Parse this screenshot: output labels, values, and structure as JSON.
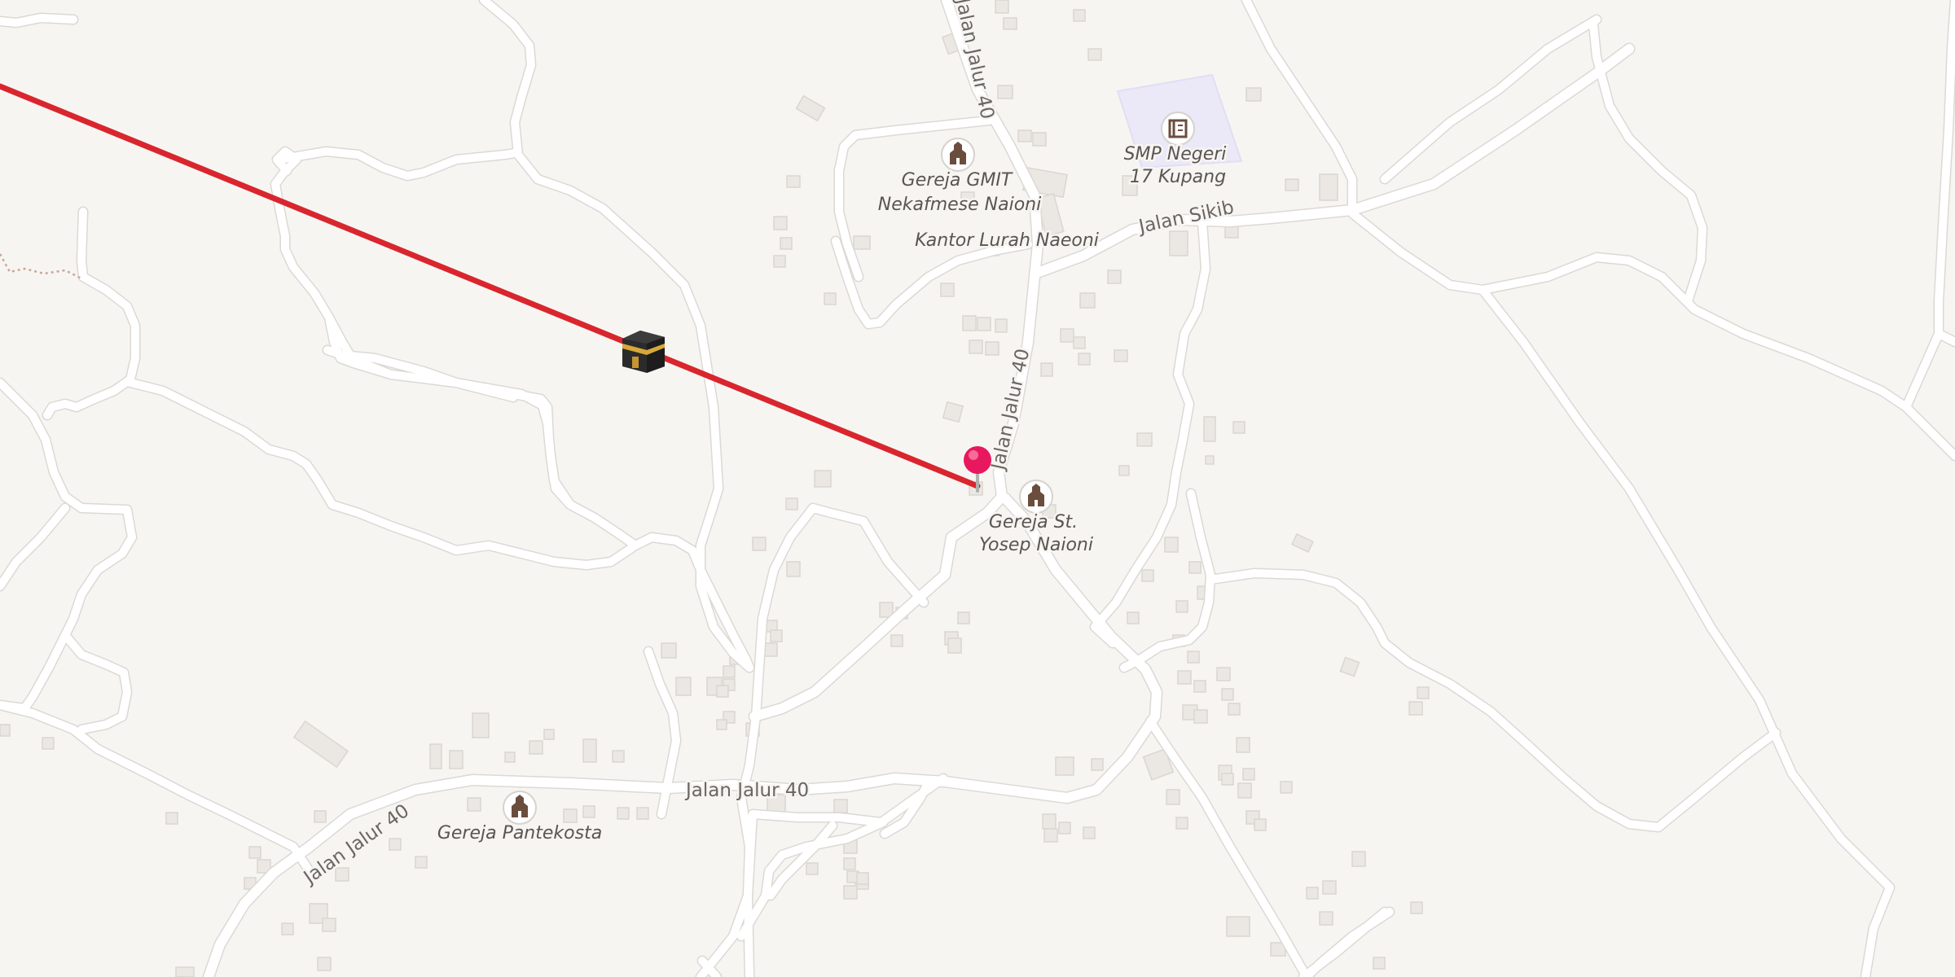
{
  "map": {
    "colors": {
      "background": "#f7f5f2",
      "road": "#ffffff",
      "road_casing": "#dcd9d4",
      "building": "#ebe8e4",
      "school_area": "#ebe8f7",
      "route_line": "#d9262e",
      "pin": "#e8185f",
      "poi_icon_bg": "#ffffff",
      "poi_icon": "#6b4d3e"
    },
    "route": {
      "icon": "kaaba-icon",
      "description": "Qibla direction line from pin toward Kaaba"
    },
    "pin": {
      "icon": "map-pin-icon"
    },
    "pois": [
      {
        "label_lines": [
          "Gereja GMIT",
          "Nekafmese Naioni"
        ],
        "icon": "church-icon"
      },
      {
        "label_lines": [
          "SMP Negeri",
          "17 Kupang"
        ],
        "icon": "school-icon"
      },
      {
        "label_lines": [
          "Kantor Lurah Naeoni"
        ],
        "icon": ""
      },
      {
        "label_lines": [
          "Gereja St.",
          "Yosep Naioni"
        ],
        "icon": "church-icon"
      },
      {
        "label_lines": [
          "Gereja Pantekosta"
        ],
        "icon": "church-icon"
      }
    ],
    "streets": [
      {
        "label": "Jalan Jalur 40"
      },
      {
        "label": "Jalan Jalur 40"
      },
      {
        "label": "Jalan Sikib"
      },
      {
        "label": "Jalan Jalur 40"
      },
      {
        "label": "Jalan Jalur 40"
      }
    ]
  }
}
